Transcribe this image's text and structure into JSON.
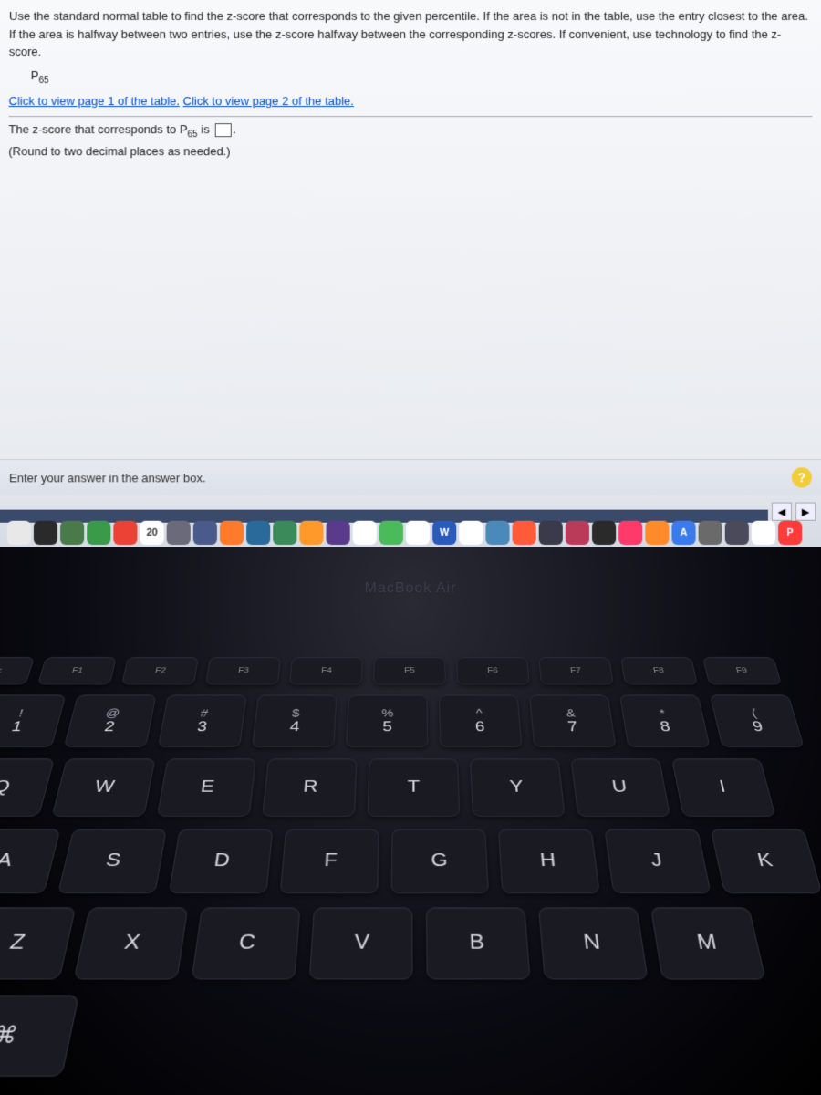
{
  "question": {
    "instructions": "Use the standard normal table to find the z-score that corresponds to the given percentile. If the area is not in the table, use the entry closest to the area. If the area is halfway between two entries, use the z-score halfway between the corresponding z-scores. If convenient, use technology to find the z-score.",
    "percentile_prefix": "P",
    "percentile_sub": "65",
    "link1": "Click to view page 1 of the table.",
    "link2": "Click to view page 2 of the table.",
    "answer_before": "The z-score that corresponds to P",
    "answer_sub": "65",
    "answer_after_sub": " is ",
    "answer_period": ".",
    "round_note": "(Round to two decimal places as needed.)",
    "footer_prompt": "Enter your answer in the answer box.",
    "help_symbol": "?",
    "nav_prev": "◀",
    "nav_next": "▶"
  },
  "dock": {
    "icons": [
      {
        "bg": "#e8e8e8",
        "txt": "",
        "name": "finder-icon"
      },
      {
        "bg": "#2a2a2a",
        "txt": "",
        "name": "system-icon"
      },
      {
        "bg": "#4a7a4a",
        "txt": "",
        "name": "messages-icon"
      },
      {
        "bg": "#3a9a4a",
        "txt": "",
        "name": "facetime-icon"
      },
      {
        "bg": "#ea4335",
        "txt": "",
        "name": "chrome-icon"
      },
      {
        "bg": "#ffffff",
        "txt": "20",
        "name": "calendar-icon",
        "color": "#333"
      },
      {
        "bg": "#6a6a7a",
        "txt": "",
        "name": "preview-icon"
      },
      {
        "bg": "#4a5a8a",
        "txt": "",
        "name": "app1-icon"
      },
      {
        "bg": "#ff7a2a",
        "txt": "",
        "name": "app2-icon"
      },
      {
        "bg": "#2a6a9a",
        "txt": "",
        "name": "app3-icon"
      },
      {
        "bg": "#3a8a5a",
        "txt": "",
        "name": "numbers-icon"
      },
      {
        "bg": "#ff9a2a",
        "txt": "",
        "name": "pages-icon"
      },
      {
        "bg": "#5a3a8a",
        "txt": "",
        "name": "podcast-icon"
      },
      {
        "bg": "#ffffff",
        "txt": "",
        "name": "photos-icon"
      },
      {
        "bg": "#4aba5a",
        "txt": "",
        "name": "app4-icon"
      },
      {
        "bg": "#ffffff",
        "txt": "",
        "name": "app5-icon"
      },
      {
        "bg": "#2a5aba",
        "txt": "W",
        "name": "word-icon"
      },
      {
        "bg": "#ffffff",
        "txt": "",
        "name": "app6-icon"
      },
      {
        "bg": "#4a8aba",
        "txt": "",
        "name": "app7-icon"
      },
      {
        "bg": "#ff5a3a",
        "txt": "",
        "name": "app8-icon"
      },
      {
        "bg": "#3a3a4a",
        "txt": "",
        "name": "app9-icon"
      },
      {
        "bg": "#ba3a5a",
        "txt": "",
        "name": "app10-icon"
      },
      {
        "bg": "#2a2a2a",
        "txt": "",
        "name": "app11-icon"
      },
      {
        "bg": "#ff3a6a",
        "txt": "",
        "name": "music-icon"
      },
      {
        "bg": "#ff8a2a",
        "txt": "",
        "name": "app12-icon"
      },
      {
        "bg": "#3a7aea",
        "txt": "A",
        "name": "appstore-icon"
      },
      {
        "bg": "#6a6a6a",
        "txt": "",
        "name": "settings-icon"
      },
      {
        "bg": "#4a4a5a",
        "txt": "",
        "name": "app13-icon"
      },
      {
        "bg": "#ffffff",
        "txt": "",
        "name": "app14-icon"
      },
      {
        "bg": "#ff3a3a",
        "txt": "P",
        "name": "app15-icon"
      }
    ]
  },
  "laptop": {
    "brand": "MacBook Air"
  },
  "keyboard": {
    "fn": [
      {
        "t": "esc"
      },
      {
        "t": "F1"
      },
      {
        "t": "F2"
      },
      {
        "t": "F3"
      },
      {
        "t": "F4"
      },
      {
        "t": "F5"
      },
      {
        "t": "F6"
      },
      {
        "t": "F7"
      },
      {
        "t": "F8"
      },
      {
        "t": "F9"
      }
    ],
    "num": [
      {
        "top": "!",
        "bot": "1"
      },
      {
        "top": "@",
        "bot": "2"
      },
      {
        "top": "#",
        "bot": "3"
      },
      {
        "top": "$",
        "bot": "4"
      },
      {
        "top": "%",
        "bot": "5"
      },
      {
        "top": "^",
        "bot": "6"
      },
      {
        "top": "&",
        "bot": "7"
      },
      {
        "top": "*",
        "bot": "8"
      },
      {
        "top": "(",
        "bot": "9"
      }
    ],
    "row1": [
      "Q",
      "W",
      "E",
      "R",
      "T",
      "Y",
      "U",
      "I"
    ],
    "row2": [
      "A",
      "S",
      "D",
      "F",
      "G",
      "H",
      "J",
      "K"
    ],
    "row3": [
      "Z",
      "X",
      "C",
      "V",
      "B",
      "N",
      "M"
    ],
    "cmd": "⌘"
  }
}
